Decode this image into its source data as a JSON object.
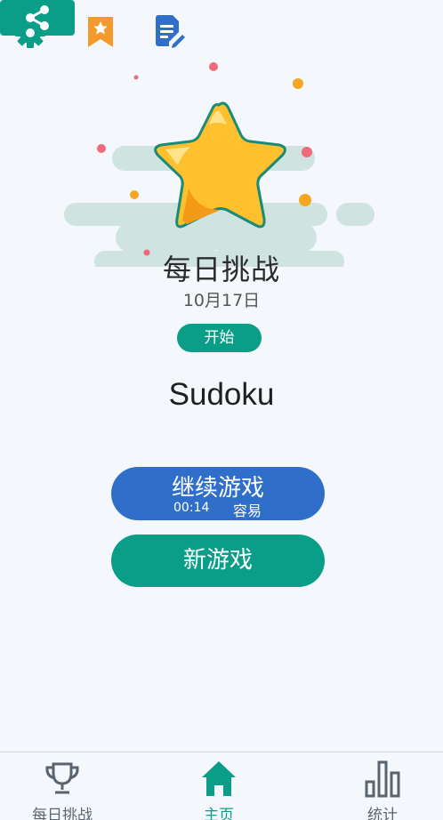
{
  "daily": {
    "title": "每日挑战",
    "date": "10月17日",
    "start_label": "开始"
  },
  "app": {
    "title": "Sudoku"
  },
  "continue_game": {
    "label": "继续游戏",
    "time": "00:14",
    "difficulty": "容易"
  },
  "new_game": {
    "label": "新游戏"
  },
  "nav": {
    "items": [
      {
        "label": "每日挑战",
        "icon": "trophy-icon",
        "active": false
      },
      {
        "label": "主页",
        "icon": "home-icon",
        "active": true
      },
      {
        "label": "统计",
        "icon": "bar-chart-icon",
        "active": false
      }
    ]
  },
  "colors": {
    "primary": "#0a9e88",
    "secondary": "#2f6fc9",
    "bookmark": "#f39a2b",
    "star": "#ffc02e"
  }
}
